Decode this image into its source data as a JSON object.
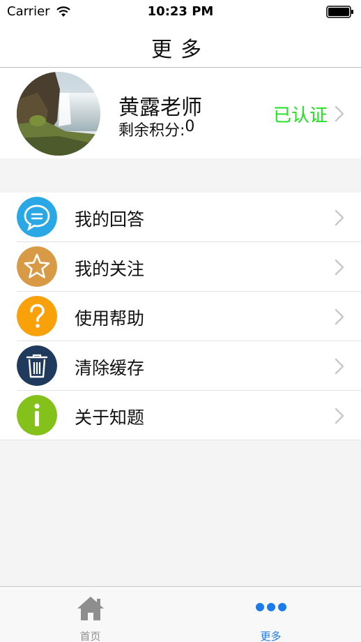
{
  "status_bar": {
    "carrier": "Carrier",
    "time": "10:23 PM"
  },
  "nav": {
    "title": "更多"
  },
  "profile": {
    "name": "黄露老师",
    "points_label": "剩余积分:",
    "points_value": "0",
    "verified_label": "已认证",
    "verified_color": "#1fe11f"
  },
  "menu": {
    "items": [
      {
        "label": "我的回答",
        "icon": "chat-bubble-icon",
        "color": "#2aa8e6"
      },
      {
        "label": "我的关注",
        "icon": "star-icon",
        "color": "#d99a46"
      },
      {
        "label": "使用帮助",
        "icon": "question-icon",
        "color": "#f8a10a"
      },
      {
        "label": "清除缓存",
        "icon": "trash-icon",
        "color": "#1f3a5c"
      },
      {
        "label": "关于知题",
        "icon": "info-icon",
        "color": "#84c21b"
      }
    ]
  },
  "tabbar": {
    "home_label": "首页",
    "more_label": "更多",
    "active_color": "#1b7bea",
    "inactive_color": "#8e8e8e"
  }
}
